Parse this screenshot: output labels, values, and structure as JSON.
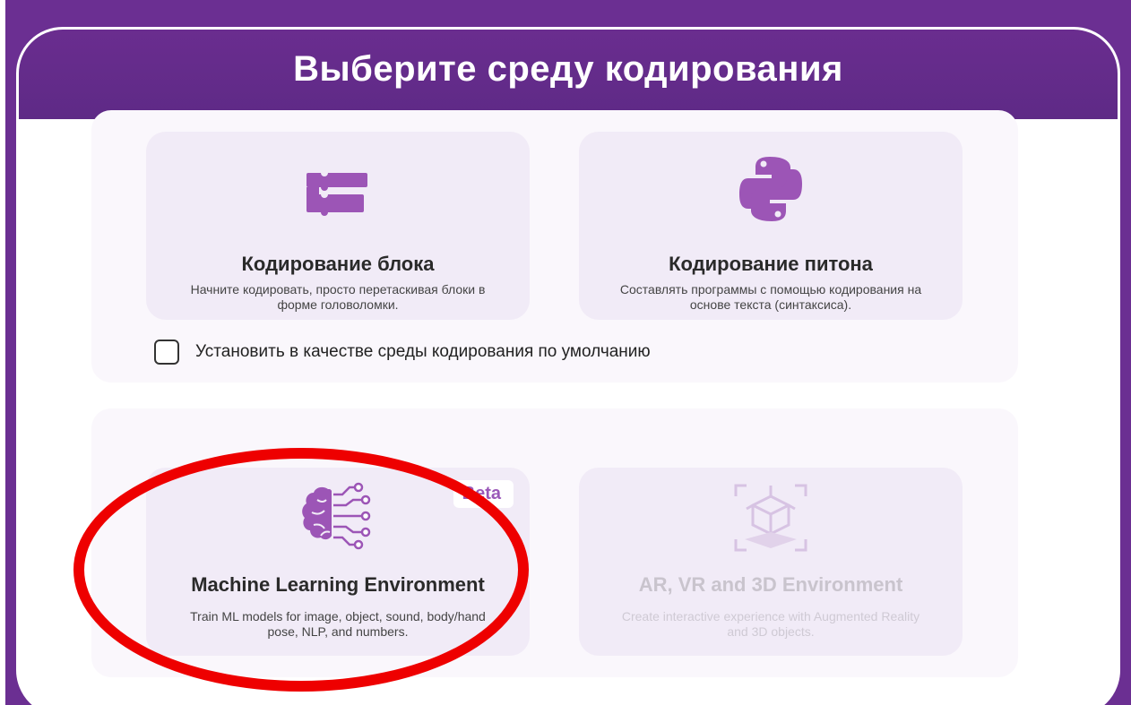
{
  "dialog": {
    "title": "Выберите среду кодирования"
  },
  "environments": [
    {
      "title": "Кодирование блока",
      "description": "Начните кодировать, просто перетаскивая блоки в форме головоломки.",
      "icon": "blocks-icon"
    },
    {
      "title": "Кодирование питона",
      "description": "Составлять программы с помощью кодирования на основе текста (синтаксиса).",
      "icon": "python-icon"
    },
    {
      "title": "Machine Learning Environment",
      "description": "Train ML models for image, object, sound, body/hand pose, NLP, and numbers.",
      "badge": "Beta",
      "icon": "brain-circuit-icon"
    },
    {
      "title": "AR, VR and 3D Environment",
      "description": "Create interactive experience with Augmented Reality and 3D objects.",
      "icon": "ar-cube-icon",
      "disabled": true
    }
  ],
  "default_checkbox": {
    "label": "Установить в качестве среды кодирования по умолчанию",
    "checked": false
  },
  "colors": {
    "header": "#5e2a86",
    "accent": "#9a58b8",
    "annotation": "#ee0000"
  }
}
